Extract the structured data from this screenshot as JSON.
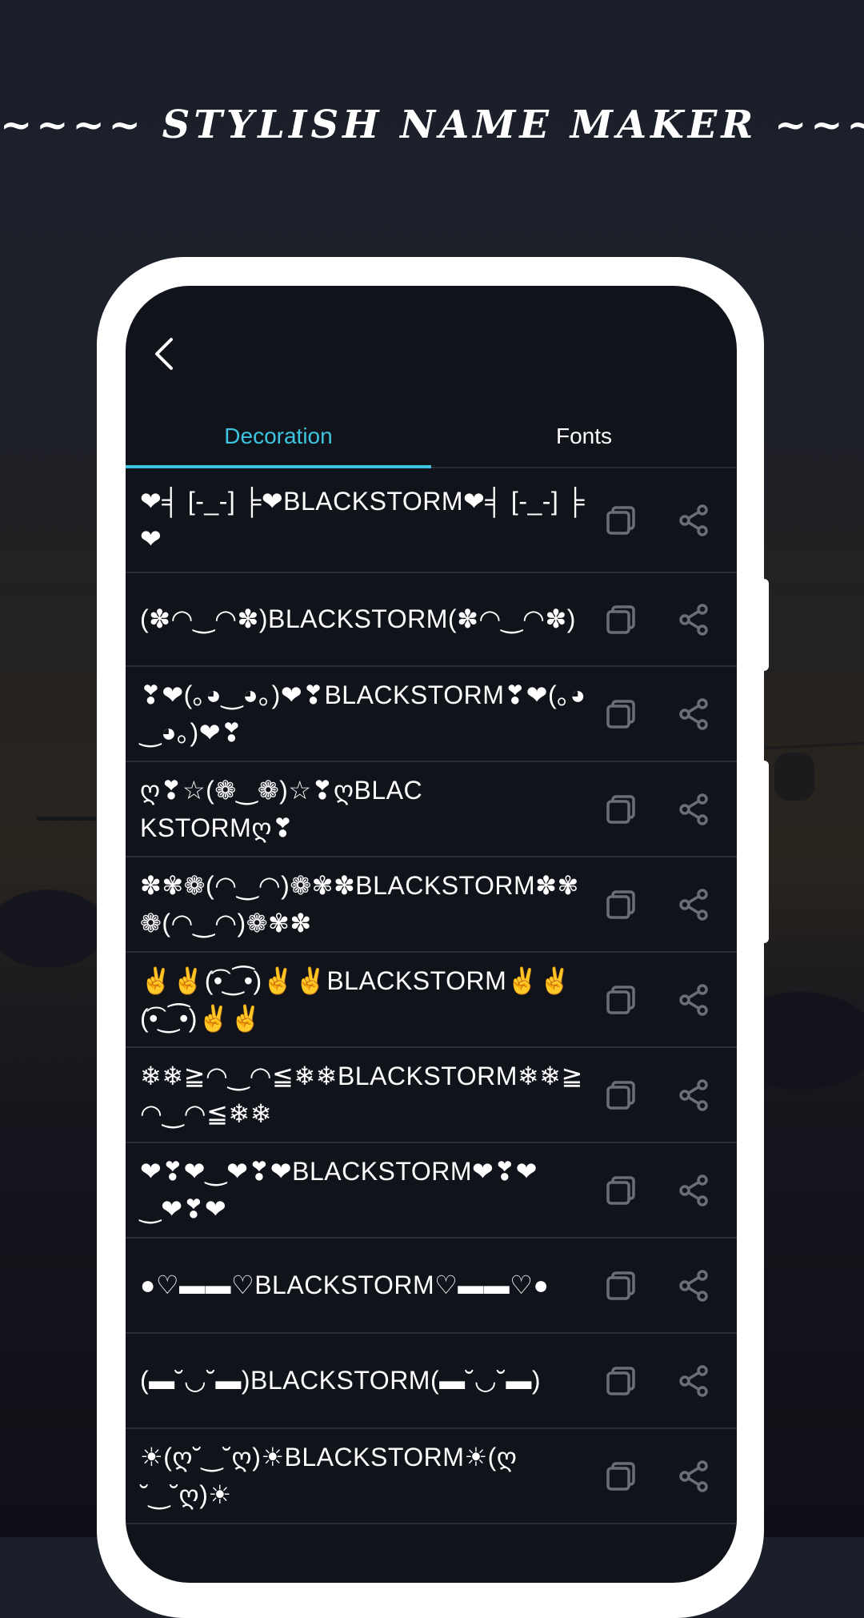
{
  "app_title": "~~~~ STYLISH NAME MAKER ~~~~",
  "screen": {
    "back_icon": "chevron-left-icon",
    "tabs": [
      {
        "label": "Decoration",
        "active": true
      },
      {
        "label": "Fonts",
        "active": false
      }
    ],
    "accent_color": "#3ec4e0",
    "list": [
      {
        "text": "❤╡ [-_-] ╞❤BLACKSTORM❤╡ [-_-] ╞❤"
      },
      {
        "text": "(✽◠‿◠✽)BLACKSTORM(✽◠‿◠✽)"
      },
      {
        "text": "❣❤(｡◕‿◕｡)❤❣BLACKSTORM❣❤(｡◕‿◕｡)❤❣"
      },
      {
        "text": "ღ❣☆(❁‿❁)☆❣ღBLACKSTORMღ❣"
      },
      {
        "text": "✽✾❁(◠‿◠)❁✾✽BLACKSTORM✽✾❁(◠‿◠)❁✾✽"
      },
      {
        "text": "✌✌(͡•‿͡•)✌✌BLACKSTORM✌✌(͡•‿͡•)✌✌"
      },
      {
        "text": "❄❄≧◠‿◠≦❄❄BLACKSTORM❄❄≧◠‿◠≦❄❄"
      },
      {
        "text": "❤❣❤‿❤❣❤BLACKSTORM❤❣❤‿❤❣❤"
      },
      {
        "text": "●♡▬▬♡BLACKSTORM♡▬▬♡●"
      },
      {
        "text": "(▬˘◡˘▬)BLACKSTORM(▬˘◡˘▬)"
      },
      {
        "text": "☀(ღ˘‿˘ღ)☀BLACKSTORM☀(ღ˘‿˘ღ)☀"
      }
    ],
    "row_actions": {
      "copy_icon": "copy-icon",
      "share_icon": "share-icon"
    }
  }
}
